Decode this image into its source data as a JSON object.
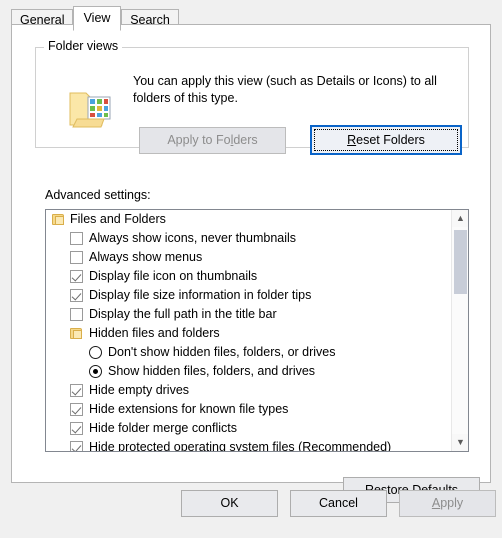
{
  "dialog": {
    "tabs": [
      {
        "id": "general",
        "label": "General",
        "active": false
      },
      {
        "id": "view",
        "label": "View",
        "active": true
      },
      {
        "id": "search",
        "label": "Search",
        "active": false
      }
    ]
  },
  "folder_views": {
    "legend": "Folder views",
    "description": "You can apply this view (such as Details or Icons) to all folders of this type.",
    "icon": "folder-views-icon",
    "apply_to_folders": {
      "label": "Apply to Folders",
      "enabled": false
    },
    "reset_folders": {
      "label": "Reset Folders",
      "enabled": true,
      "focused": true
    }
  },
  "advanced": {
    "label": "Advanced settings:",
    "items": [
      {
        "type": "group",
        "label": "Files and Folders"
      },
      {
        "type": "checkbox",
        "label": "Always show icons, never thumbnails",
        "checked": false
      },
      {
        "type": "checkbox",
        "label": "Always show menus",
        "checked": false
      },
      {
        "type": "checkbox",
        "label": "Display file icon on thumbnails",
        "checked": true
      },
      {
        "type": "checkbox",
        "label": "Display file size information in folder tips",
        "checked": true
      },
      {
        "type": "checkbox",
        "label": "Display the full path in the title bar",
        "checked": false
      },
      {
        "type": "group",
        "label": "Hidden files and folders"
      },
      {
        "type": "radio",
        "label": "Don't show hidden files, folders, or drives",
        "selected": false
      },
      {
        "type": "radio",
        "label": "Show hidden files, folders, and drives",
        "selected": true
      },
      {
        "type": "checkbox",
        "label": "Hide empty drives",
        "checked": true
      },
      {
        "type": "checkbox",
        "label": "Hide extensions for known file types",
        "checked": true
      },
      {
        "type": "checkbox",
        "label": "Hide folder merge conflicts",
        "checked": true
      },
      {
        "type": "checkbox",
        "label": "Hide protected operating system files (Recommended)",
        "checked": true
      }
    ],
    "scrollbar": {
      "up_arrow": "scroll-up-icon",
      "down_arrow": "scroll-down-icon",
      "thumb_position_percent": 5
    }
  },
  "restore_defaults": {
    "label": "Restore Defaults",
    "accelerator": "D"
  },
  "footer": {
    "ok": {
      "label": "OK",
      "enabled": true
    },
    "cancel": {
      "label": "Cancel",
      "enabled": true
    },
    "apply": {
      "label": "Apply",
      "enabled": false,
      "accelerator": "A"
    }
  }
}
